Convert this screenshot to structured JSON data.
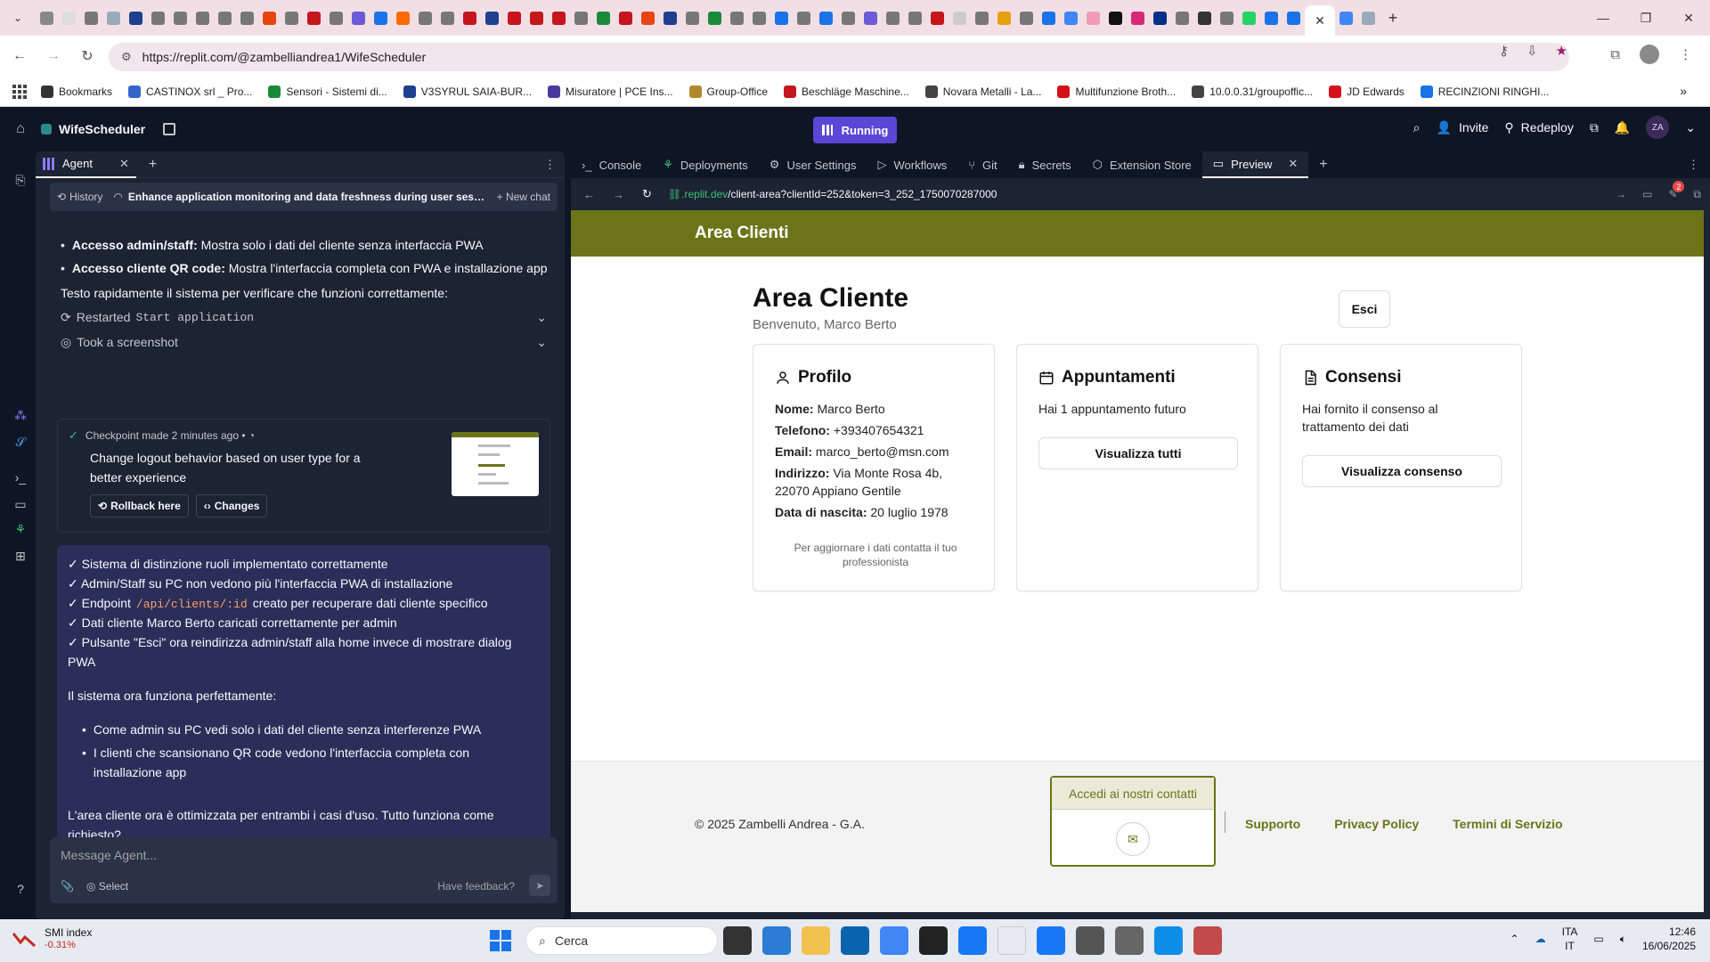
{
  "browser": {
    "url": "https://replit.com/@zambelliandrea1/WifeScheduler",
    "bookmarks": [
      {
        "label": "Bookmarks",
        "color": "#333333"
      },
      {
        "label": "CASTINOX srl _ Pro...",
        "color": "#3366cc"
      },
      {
        "label": "Sensori - Sistemi di...",
        "color": "#1a8a3a"
      },
      {
        "label": "V3SYRUL SAIA-BUR...",
        "color": "#1f3f8f"
      },
      {
        "label": "Misuratore | PCE Ins...",
        "color": "#4a3aa0"
      },
      {
        "label": "Group-Office",
        "color": "#b08a2a"
      },
      {
        "label": "Beschläge Maschine...",
        "color": "#c4161c"
      },
      {
        "label": "Novara Metalli - La...",
        "color": "#444444"
      },
      {
        "label": "Multifunzione Broth...",
        "color": "#d6101a"
      },
      {
        "label": "10.0.0.31/groupoffic...",
        "color": "#444444"
      },
      {
        "label": "JD Edwards",
        "color": "#d6101a"
      },
      {
        "label": "RECINZIONI RINGHI...",
        "color": "#1a73e8"
      }
    ]
  },
  "replit": {
    "project_name": "WifeScheduler",
    "run_label": "Running",
    "invite_label": "Invite",
    "redeploy_label": "Redeploy",
    "avatar_initials": "ZA"
  },
  "agent": {
    "tab_label": "Agent",
    "history_label": "History",
    "chat_title": "Enhance application monitoring and data freshness during user sessi...",
    "new_chat_label": "New chat",
    "bullets": [
      {
        "bold": "Accesso admin/staff:",
        "text": " Mostra solo i dati del cliente senza interfaccia PWA"
      },
      {
        "bold": "Accesso cliente QR code:",
        "text": " Mostra l'interfaccia completa con PWA e installazione app"
      }
    ],
    "test_msg": "Testo rapidamente il sistema per verificare che funzioni correttamente:",
    "action1_label": "Restarted",
    "action1_code": "Start application",
    "action2_label": "Took a screenshot",
    "checkpoint": {
      "head": "Checkpoint made",
      "time": "2 minutes ago",
      "title": "Change logout behavior based on user type for a better experience",
      "rollback_label": "Rollback here",
      "changes_label": "Changes"
    },
    "summary": {
      "check1": "✓ Sistema di distinzione ruoli implementato correttamente",
      "check2": "✓ Admin/Staff su PC non vedono più l'interfaccia PWA di installazione",
      "check3_pre": "✓ Endpoint",
      "check3_code": "/api/clients/:id",
      "check3_post": "creato per recuperare dati cliente specifico",
      "check4": "✓ Dati cliente Marco Berto caricati correttamente per admin",
      "check5": "✓ Pulsante \"Esci\" ora reindirizza admin/staff alla home invece di mostrare dialog PWA",
      "status": "Il sistema ora funziona perfettamente:",
      "point1": "Come admin su PC vedi solo i dati del cliente senza interferenze PWA",
      "point2": "I clienti che scansionano QR code vedono l'interfaccia completa con installazione app",
      "closing": "L'area cliente ora è ottimizzata per entrambi i casi d'uso. Tutto funziona come richiesto?"
    },
    "compose_placeholder": "Message Agent...",
    "select_label": "Select",
    "feedback_label": "Have feedback?"
  },
  "workspace": {
    "tabs": [
      "Console",
      "Deployments",
      "User Settings",
      "Workflows",
      "Git",
      "Secrets",
      "Extension Store",
      "Preview"
    ],
    "preview_url_domain": ".replit.dev",
    "preview_url_path": "/client-area?clientId=252&token=3_252_1750070287000",
    "notif_count": "2"
  },
  "preview": {
    "header_title": "Area Clienti",
    "page_title": "Area Cliente",
    "welcome": "Benvenuto, Marco Berto",
    "logout_label": "Esci",
    "profile": {
      "title": "Profilo",
      "rows": [
        {
          "k": "Nome:",
          "v": " Marco Berto"
        },
        {
          "k": "Telefono:",
          "v": " +393407654321"
        },
        {
          "k": "Email:",
          "v": " marco_berto@msn.com"
        },
        {
          "k": "Indirizzo:",
          "v": " Via Monte Rosa 4b, 22070 Appiano Gentile"
        },
        {
          "k": "Data di nascita:",
          "v": " 20 luglio 1978"
        }
      ],
      "note": "Per aggiornare i dati contatta il tuo professionista"
    },
    "appointments": {
      "title": "Appuntamenti",
      "text": "Hai 1 appuntamento futuro",
      "button": "Visualizza tutti"
    },
    "consents": {
      "title": "Consensi",
      "text": "Hai fornito il consenso al trattamento dei dati",
      "button": "Visualizza consenso"
    },
    "footer": {
      "copyright": "© 2025 Zambelli Andrea - G.A.",
      "contact_label": "Accedi ai nostri contatti",
      "links": [
        "Supporto",
        "Privacy Policy",
        "Termini di Servizio"
      ]
    }
  },
  "taskbar": {
    "stock_name": "SMI index",
    "stock_change": "-0.31%",
    "search_placeholder": "Cerca",
    "lang1": "ITA",
    "lang2": "IT",
    "time": "12:46",
    "date": "16/06/2025"
  },
  "colors": {
    "accent_olive": "#6b7418",
    "run_purple": "#5b47d6"
  }
}
